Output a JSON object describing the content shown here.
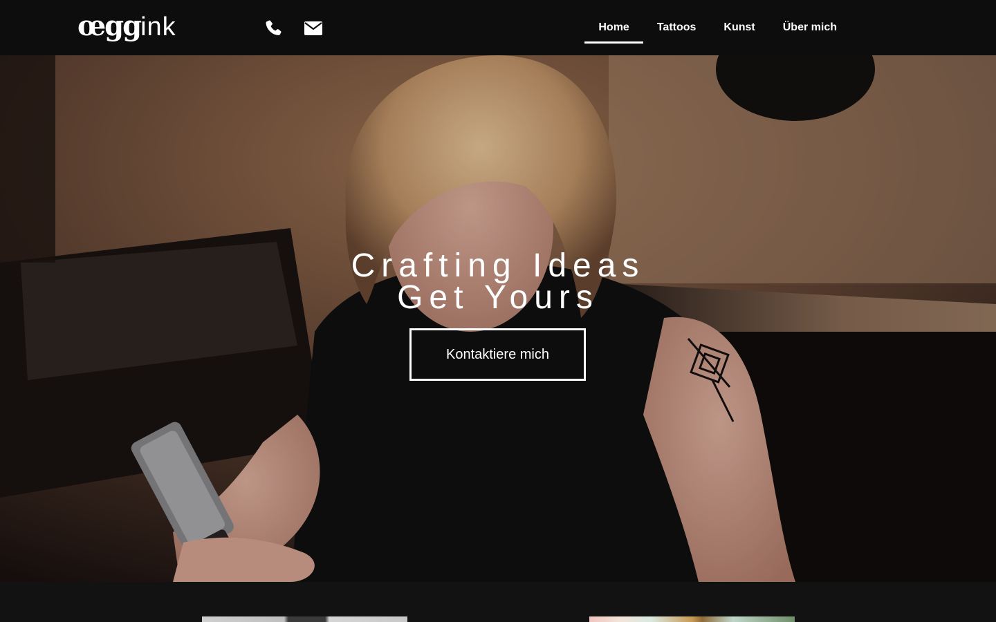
{
  "brand": {
    "logo_part_a": "œgg",
    "logo_part_b": "ink"
  },
  "header": {
    "contact_icons": [
      "phone-icon",
      "envelope-icon"
    ],
    "nav": [
      {
        "label": "Home",
        "active": true
      },
      {
        "label": "Tattoos",
        "active": false
      },
      {
        "label": "Kunst",
        "active": false
      },
      {
        "label": "Über mich",
        "active": false
      }
    ]
  },
  "hero": {
    "title_line_1": "Crafting Ideas",
    "title_line_2": "Get Yours",
    "cta_label": "Kontaktiere mich"
  },
  "colors": {
    "header_bg": "#0d0d0d",
    "page_bg": "#121212",
    "text": "#ffffff"
  }
}
